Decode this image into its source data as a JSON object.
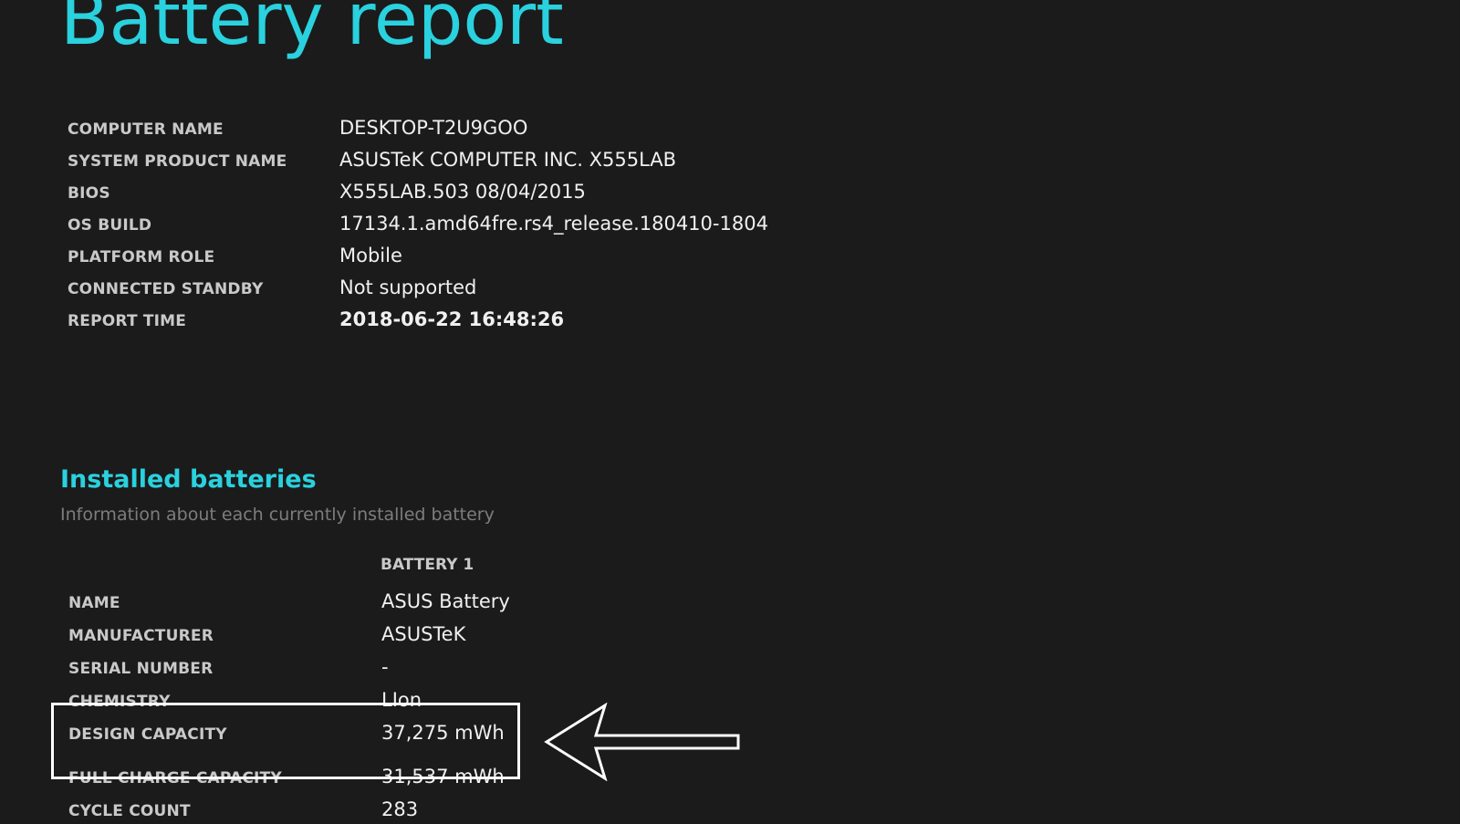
{
  "page": {
    "title": "Battery report"
  },
  "system_info": [
    {
      "label": "COMPUTER NAME",
      "value": "DESKTOP-T2U9GOO"
    },
    {
      "label": "SYSTEM PRODUCT NAME",
      "value": "ASUSTeK COMPUTER INC. X555LAB"
    },
    {
      "label": "BIOS",
      "value": "X555LAB.503 08/04/2015"
    },
    {
      "label": "OS BUILD",
      "value": "17134.1.amd64fre.rs4_release.180410-1804"
    },
    {
      "label": "PLATFORM ROLE",
      "value": "Mobile"
    },
    {
      "label": "CONNECTED STANDBY",
      "value": "Not supported"
    },
    {
      "label": "REPORT TIME",
      "value": "2018-06-22  16:48:26"
    }
  ],
  "installed_batteries": {
    "title": "Installed batteries",
    "subtitle": "Information about each currently installed battery",
    "column_header": "BATTERY 1",
    "rows": [
      {
        "label": "NAME",
        "value": "ASUS Battery"
      },
      {
        "label": "MANUFACTURER",
        "value": "ASUSTeK"
      },
      {
        "label": "SERIAL NUMBER",
        "value": "-"
      },
      {
        "label": "CHEMISTRY",
        "value": "LIon"
      },
      {
        "label": "DESIGN CAPACITY",
        "value": "37,275 mWh"
      },
      {
        "label": "FULL CHARGE CAPACITY",
        "value": "31,537 mWh"
      },
      {
        "label": "CYCLE COUNT",
        "value": "283"
      }
    ]
  },
  "colors": {
    "background": "#1b1b1b",
    "accent": "#2ad1de",
    "label": "#c9c9c9",
    "value": "#f0f0f0",
    "subtitle": "#7d7d7d",
    "annotation": "#ffffff"
  },
  "annotation": {
    "icon": "left-arrow-icon"
  }
}
